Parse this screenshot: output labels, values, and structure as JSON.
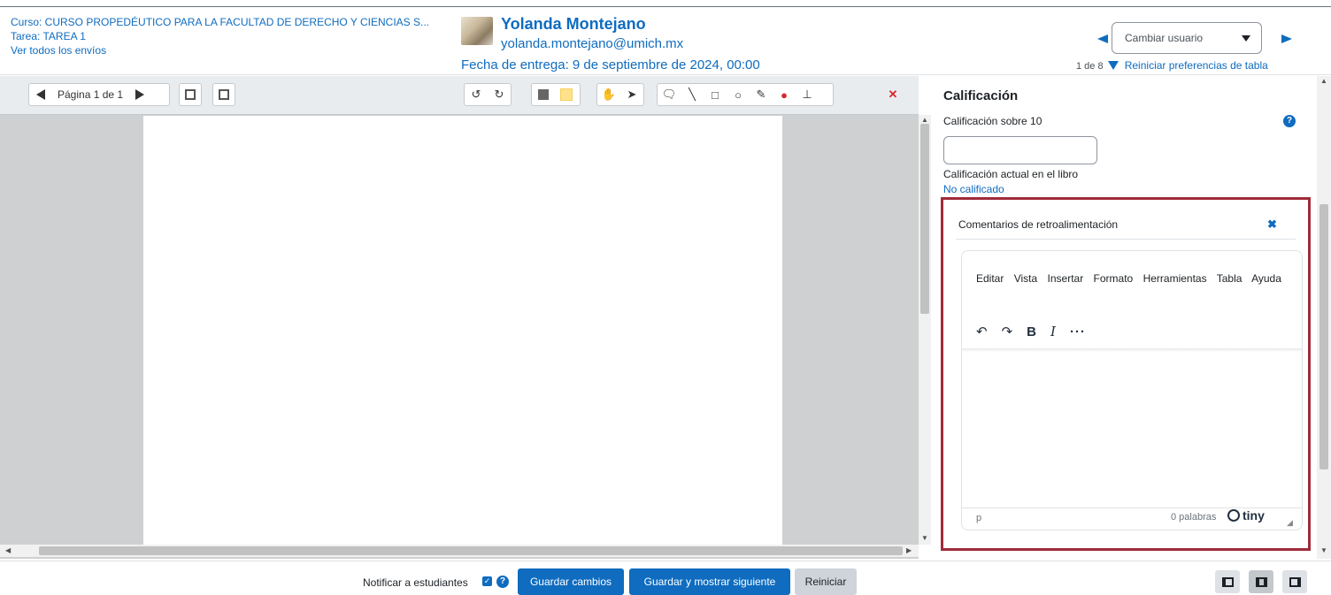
{
  "header": {
    "course": "Curso: CURSO PROPEDÉUTICO PARA LA FACULTAD DE DERECHO Y CIENCIAS S...",
    "assignment": "Tarea: TAREA 1",
    "view_all": "Ver todos los envíos",
    "user_name": "Yolanda Montejano",
    "user_email": "yolanda.montejano@umich.mx",
    "due_date": "Fecha de entrega: 9 de septiembre de 2024, 00:00",
    "change_user_placeholder": "Cambiar usuario",
    "user_count": "1 de 8",
    "reset_prefs": "Reiniciar preferencias de tabla"
  },
  "pdf_toolbar": {
    "page_label": "Página 1 de 1",
    "icons": [
      "prev-page-icon",
      "next-page-icon",
      "rotate-left-icon",
      "rotate-right-icon",
      "comment-color-icon",
      "highlight-color-icon",
      "pan-icon",
      "select-icon",
      "comment-icon",
      "line-icon",
      "rectangle-icon",
      "oval-icon",
      "pen-icon",
      "highlighter-icon",
      "stamp-icon",
      "delete-icon"
    ]
  },
  "grading": {
    "heading": "Calificación",
    "grade_out_of": "Calificación sobre 10",
    "grade_value": "",
    "gradebook_label": "Calificación actual en el libro",
    "gradebook_value": "No calificado"
  },
  "feedback": {
    "title": "Comentarios de retroalimentación",
    "menu": [
      "Editar",
      "Vista",
      "Insertar",
      "Formato",
      "Herramientas",
      "Tabla",
      "Ayuda"
    ],
    "status_tag": "p",
    "word_count": "0 palabras",
    "brand": "tiny"
  },
  "footer": {
    "notify_label": "Notificar a estudiantes",
    "notify_checked": true,
    "save": "Guardar cambios",
    "save_next": "Guardar y mostrar siguiente",
    "reset": "Reiniciar"
  },
  "colors": {
    "accent": "#0f6cbf",
    "highlight_border": "#a02b3a"
  }
}
